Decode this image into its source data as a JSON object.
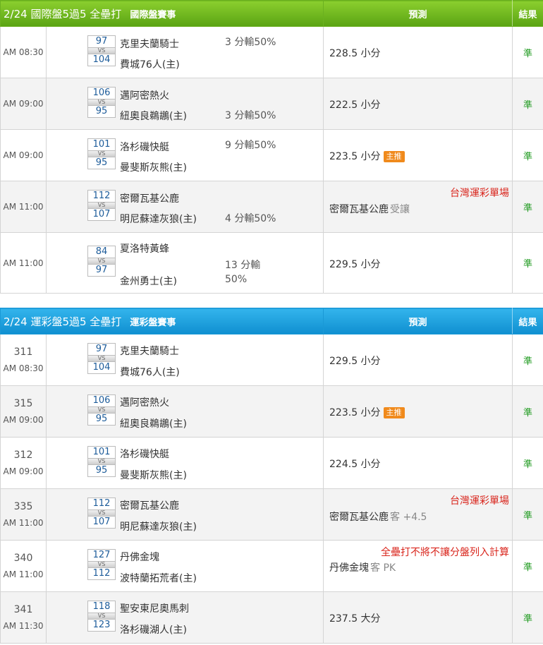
{
  "sections": [
    {
      "title": "2/24 國際盤5過5 全壘打",
      "subtitle": "國際盤賽事",
      "pred_header": "預測",
      "result_header": "結果",
      "rows": [
        {
          "code": "",
          "time": "AM 08:30",
          "away": "克里夫蘭騎士",
          "home": "費城76人(主)",
          "away_score": "97",
          "home_score": "104",
          "vs": "VS",
          "handicap": "3 分輸50%",
          "pred": "228.5 小分",
          "pred_extra": "",
          "badge": "",
          "note": "",
          "result": "準"
        },
        {
          "code": "",
          "time": "AM 09:00",
          "away": "邁阿密熱火",
          "home": "紐奧良鵜鶘(主)",
          "away_score": "106",
          "home_score": "95",
          "vs": "VS",
          "handicap": "3 分輸50%",
          "pred": "222.5 小分",
          "pred_extra": "",
          "badge": "",
          "note": "",
          "result": "準"
        },
        {
          "code": "",
          "time": "AM 09:00",
          "away": "洛杉磯快艇",
          "home": "曼斐斯灰熊(主)",
          "away_score": "101",
          "home_score": "95",
          "vs": "VS",
          "handicap": "9 分輸50%",
          "pred": "223.5 小分",
          "pred_extra": "",
          "badge": "主推",
          "note": "",
          "result": "準"
        },
        {
          "code": "",
          "time": "AM 11:00",
          "away": "密爾瓦基公鹿",
          "home": "明尼蘇達灰狼(主)",
          "away_score": "112",
          "home_score": "107",
          "vs": "VS",
          "handicap": "4 分輸50%",
          "pred": "密爾瓦基公鹿",
          "pred_extra": "受讓",
          "badge": "",
          "note": "台灣運彩單場",
          "result": "準"
        },
        {
          "code": "",
          "time": "AM 11:00",
          "away": "夏洛特黃蜂",
          "home": "金州勇士(主)",
          "away_score": "84",
          "home_score": "97",
          "vs": "VS",
          "handicap": "13 分輸",
          "handicap2": "50%",
          "pred": "229.5 小分",
          "pred_extra": "",
          "badge": "",
          "note": "",
          "result": "準"
        }
      ]
    },
    {
      "title": "2/24 運彩盤5過5 全壘打",
      "subtitle": "運彩盤賽事",
      "pred_header": "預測",
      "result_header": "結果",
      "rows": [
        {
          "code": "311",
          "time": "AM 08:30",
          "away": "克里夫蘭騎士",
          "home": "費城76人(主)",
          "away_score": "97",
          "home_score": "104",
          "vs": "VS",
          "handicap": "",
          "pred": "229.5 小分",
          "pred_extra": "",
          "badge": "",
          "note": "",
          "result": "準"
        },
        {
          "code": "315",
          "time": "AM 09:00",
          "away": "邁阿密熱火",
          "home": "紐奧良鵜鶘(主)",
          "away_score": "106",
          "home_score": "95",
          "vs": "VS",
          "handicap": "",
          "pred": "223.5 小分",
          "pred_extra": "",
          "badge": "主推",
          "note": "",
          "result": "準"
        },
        {
          "code": "312",
          "time": "AM 09:00",
          "away": "洛杉磯快艇",
          "home": "曼斐斯灰熊(主)",
          "away_score": "101",
          "home_score": "95",
          "vs": "VS",
          "handicap": "",
          "pred": "224.5 小分",
          "pred_extra": "",
          "badge": "",
          "note": "",
          "result": "準"
        },
        {
          "code": "335",
          "time": "AM 11:00",
          "away": "密爾瓦基公鹿",
          "home": "明尼蘇達灰狼(主)",
          "away_score": "112",
          "home_score": "107",
          "vs": "VS",
          "handicap": "",
          "pred": "密爾瓦基公鹿",
          "pred_extra": "客 +4.5",
          "badge": "",
          "note": "台灣運彩單場",
          "result": "準"
        },
        {
          "code": "340",
          "time": "AM 11:00",
          "away": "丹佛金塊",
          "home": "波特蘭拓荒者(主)",
          "away_score": "127",
          "home_score": "112",
          "vs": "VS",
          "handicap": "",
          "pred": "丹佛金塊",
          "pred_extra": "客 PK",
          "badge": "",
          "note": "全壘打不將不讓分盤列入計算",
          "result": "準"
        },
        {
          "code": "341",
          "time": "AM 11:30",
          "away": "聖安東尼奧馬刺",
          "home": "洛杉磯湖人(主)",
          "away_score": "118",
          "home_score": "123",
          "vs": "VS",
          "handicap": "",
          "pred": "237.5 大分",
          "pred_extra": "",
          "badge": "",
          "note": "",
          "result": "準"
        }
      ]
    }
  ]
}
